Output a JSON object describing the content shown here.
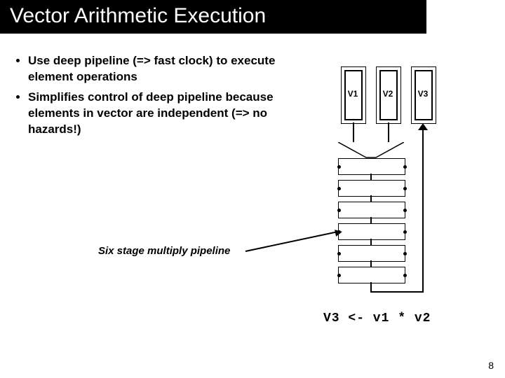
{
  "title": "Vector Arithmetic Execution",
  "bullets": {
    "b1": "Use deep pipeline (=> fast clock) to execute element operations",
    "b2": "Simplifies control of deep pipeline because elements in vector are independent (=> no hazards!)"
  },
  "diagram": {
    "regs": {
      "v1": "V1",
      "v2": "V2",
      "v3": "V3"
    },
    "caption": "Six stage multiply pipeline"
  },
  "equation": "V3 <- v1 * v2",
  "page_number": "8"
}
